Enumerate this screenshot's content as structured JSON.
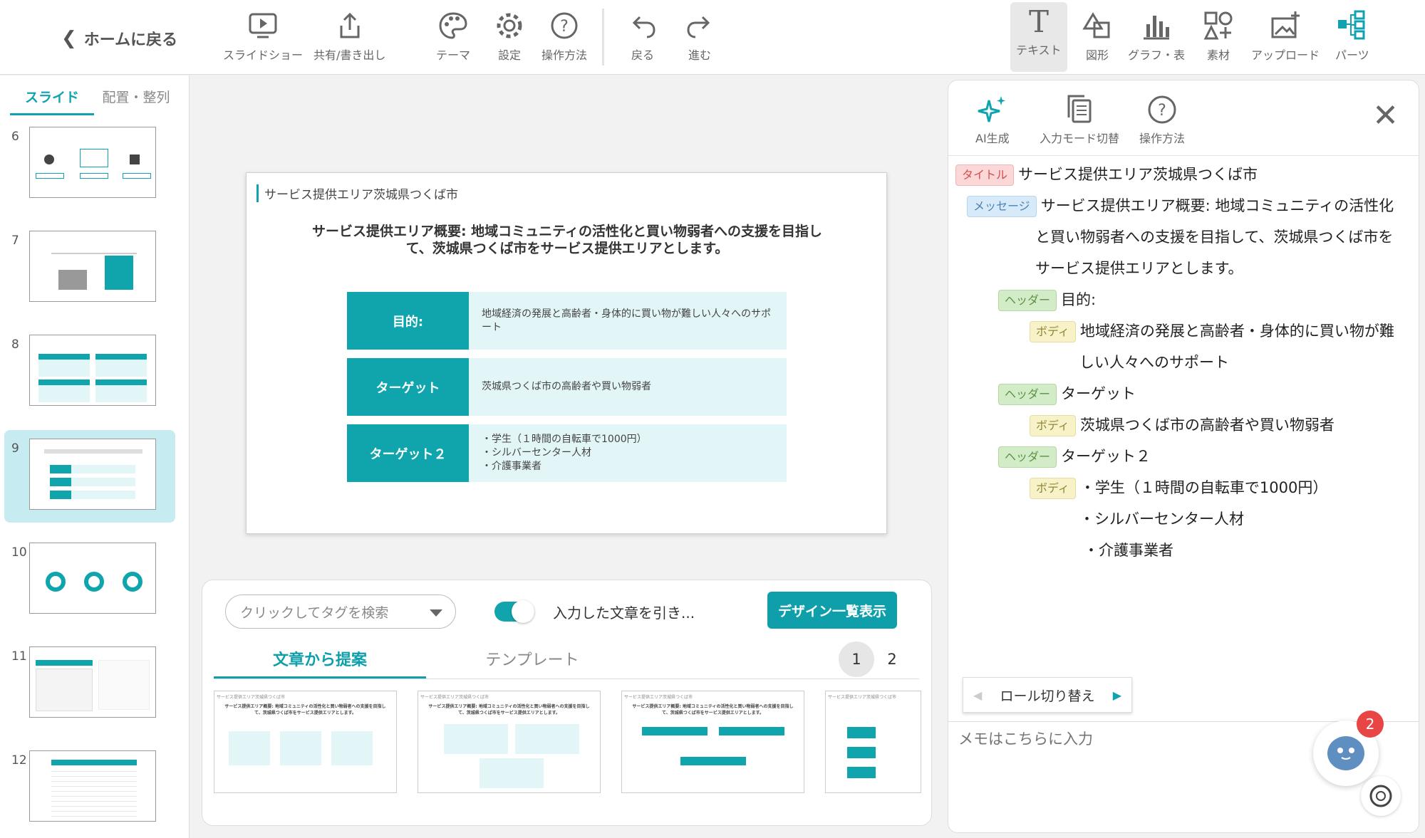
{
  "toolbar": {
    "back_label": "ホームに戻る",
    "buttons": [
      {
        "label": "スライドショー",
        "icon": "slideshow-icon"
      },
      {
        "label": "共有/書き出し",
        "icon": "share-icon"
      },
      {
        "label": "テーマ",
        "icon": "palette-icon"
      },
      {
        "label": "設定",
        "icon": "gear-icon"
      },
      {
        "label": "操作方法",
        "icon": "help-icon"
      },
      {
        "label": "戻る",
        "icon": "undo-icon"
      },
      {
        "label": "進む",
        "icon": "redo-icon"
      },
      {
        "label": "テキスト",
        "icon": "text-icon",
        "active": true
      },
      {
        "label": "図形",
        "icon": "shape-icon"
      },
      {
        "label": "グラフ・表",
        "icon": "chart-icon"
      },
      {
        "label": "素材",
        "icon": "assets-icon"
      },
      {
        "label": "アップロード",
        "icon": "upload-icon"
      },
      {
        "label": "パーツ",
        "icon": "parts-icon"
      }
    ]
  },
  "sidebar": {
    "tabs": [
      "スライド",
      "配置・整列"
    ],
    "active_tab": 0,
    "slides": [
      {
        "num": "6"
      },
      {
        "num": "7"
      },
      {
        "num": "8"
      },
      {
        "num": "9",
        "selected": true
      },
      {
        "num": "10"
      },
      {
        "num": "11"
      },
      {
        "num": "12"
      }
    ]
  },
  "slide": {
    "label": "サービス提供エリア茨城県つくば市",
    "message": "サービス提供エリア概要: 地域コミュニティの活性化と買い物弱者への支援を目指して、茨城県つくば市をサービス提供エリアとします。",
    "rows": [
      {
        "header": "目的:",
        "body": "地域経済の発展と高齢者・身体的に買い物が難しい人々へのサポート"
      },
      {
        "header": "ターゲット",
        "body": "茨城県つくば市の高齢者や買い物弱者"
      },
      {
        "header": "ターゲット２",
        "body": "・学生（１時間の自転車で1000円）\n・シルバーセンター人材\n・介護事業者"
      }
    ]
  },
  "proposal": {
    "search_placeholder": "クリックしてタグを検索",
    "toggle_label": "入力した文章を引き...",
    "design_button": "デザイン一覧表示",
    "tabs": [
      "文章から提案",
      "テンプレート"
    ],
    "pages": [
      "1",
      "2"
    ]
  },
  "right_panel": {
    "buttons": [
      {
        "label": "AI生成",
        "icon": "sparkle-icon"
      },
      {
        "label": "入力モード切替",
        "icon": "copy-icon"
      },
      {
        "label": "操作方法",
        "icon": "help-icon"
      }
    ],
    "close": "✕",
    "lines": [
      {
        "role": "タイトル",
        "kind": "title",
        "text": "サービス提供エリア茨城県つくば市"
      },
      {
        "role": "メッセージ",
        "kind": "msg",
        "text": "サービス提供エリア概要: 地域コミュニティの活性化"
      },
      {
        "role": "",
        "kind": "",
        "text": "と買い物弱者への支援を目指して、茨城県つくば市を"
      },
      {
        "role": "",
        "kind": "",
        "text": "サービス提供エリアとします。"
      },
      {
        "role": "ヘッダー",
        "kind": "head",
        "text": "目的:"
      },
      {
        "role": "ボディ",
        "kind": "body",
        "text": "地域経済の発展と高齢者・身体的に買い物が難"
      },
      {
        "role": "",
        "kind": "",
        "text": "しい人々へのサポート"
      },
      {
        "role": "ヘッダー",
        "kind": "head",
        "text": "ターゲット"
      },
      {
        "role": "ボディ",
        "kind": "body",
        "text": "茨城県つくば市の高齢者や買い物弱者"
      },
      {
        "role": "ヘッダー",
        "kind": "head",
        "text": "ターゲット２"
      },
      {
        "role": "ボディ",
        "kind": "body",
        "text": "・学生（１時間の自転車で1000円）"
      },
      {
        "role": "",
        "kind": "",
        "text": "・シルバーセンター人材"
      },
      {
        "role": "",
        "kind": "",
        "text": "・介護事業者"
      }
    ],
    "role_switch": "ロール切り替え",
    "memo_placeholder": "メモはこちらに入力",
    "chat_badge": "2"
  },
  "colors": {
    "accent": "#0fa3b1",
    "slide_header": "#10a5ad",
    "slide_body": "#e2f5f7"
  }
}
